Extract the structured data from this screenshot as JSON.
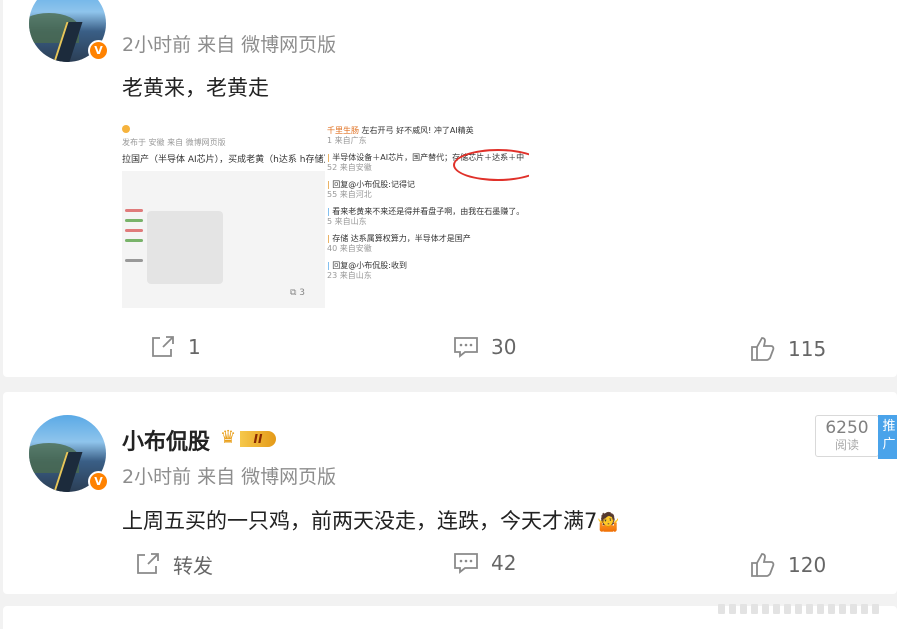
{
  "posts": [
    {
      "meta": "2小时前 来自 微博网页版",
      "text": "老黄来，老黄走",
      "verified_badge": "V",
      "image_caption_left": "发布于 安徽 来自 微博网页版",
      "image_headline_left": "拉国产（半导体 AI芯片），买成老黄（h达系 h存储）",
      "image_count": "3",
      "image_comments": [
        {
          "user": "千里生肠",
          "text": "左右开弓 好不威风! 冲了AI精英",
          "sub": "1 来自广东"
        },
        {
          "user": "",
          "text": "半导体设备＋AI芯片，国产替代；存储芯片＋达系＋中",
          "sub": "52 来自安徽"
        },
        {
          "user": "",
          "text": "回复@小布侃股:记得记",
          "sub": "55 来自河北"
        },
        {
          "user": "",
          "text": "看来老黄来不来还是得并看盘子啊，由我在石墨赚了。",
          "sub": "5 来自山东"
        },
        {
          "user": "",
          "text": "存储 达系属算权算力，半导体才是国产",
          "sub": "40 来自安徽"
        },
        {
          "user": "",
          "text": "回复@小布侃股:收到",
          "sub": "23 来自山东"
        }
      ],
      "actions": {
        "repost": "1",
        "comment": "30",
        "like": "115"
      }
    },
    {
      "name": "小布侃股",
      "vip_level": "II",
      "verified_badge": "V",
      "meta": "2小时前 来自 微博网页版",
      "text": "上周五买的一只鸡，前两天没走，连跌，今天才满7",
      "emoji": "🤷",
      "read_count": "6250",
      "read_label": "阅读",
      "ad_label": "推广",
      "actions": {
        "repost": "转发",
        "comment": "42",
        "like": "120"
      }
    }
  ],
  "icons": {
    "repost": "share-out-icon",
    "comment": "comment-bubble-icon",
    "like": "thumbs-up-icon"
  },
  "colors": {
    "badge_orange": "#ff8200",
    "ad_blue": "#4aa3ea",
    "annotation_red": "#e0312a"
  }
}
